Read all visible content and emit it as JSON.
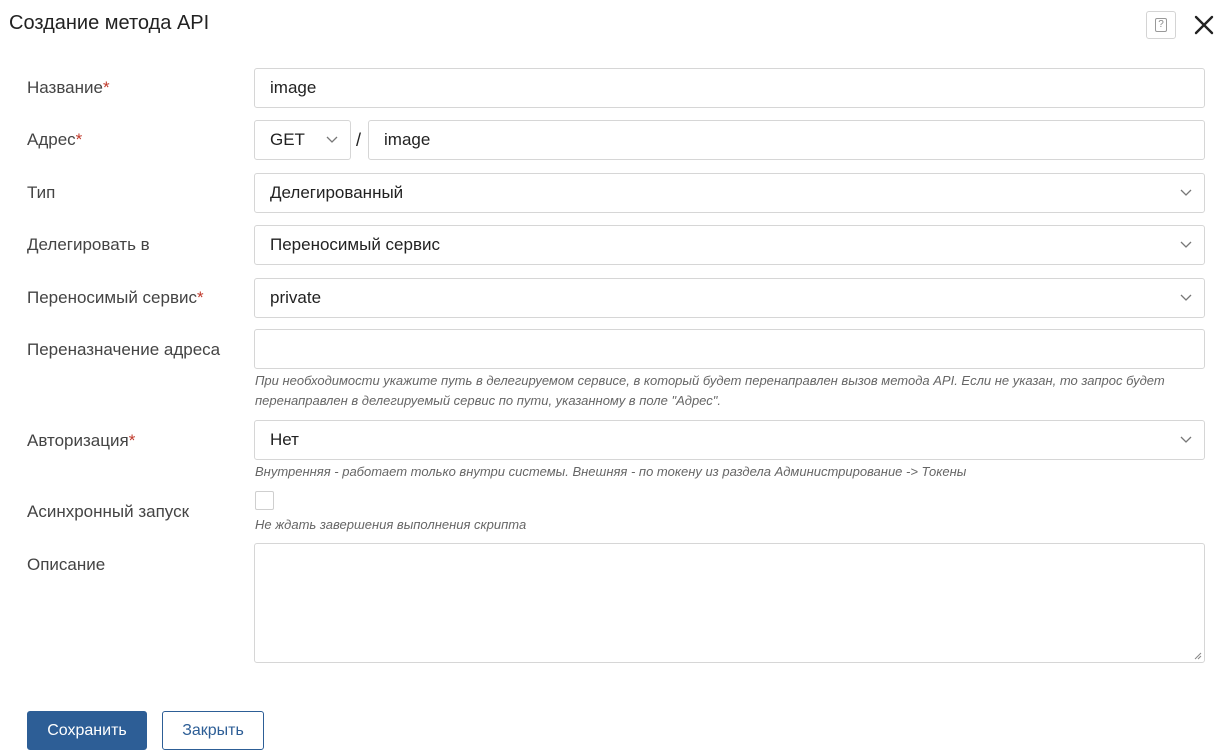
{
  "dialog": {
    "title": "Создание метода API"
  },
  "form": {
    "name": {
      "label": "Название",
      "required_mark": "*",
      "value": "image"
    },
    "address": {
      "label": "Адрес",
      "required_mark": "*",
      "method": "GET",
      "separator": "/",
      "path": "image"
    },
    "type": {
      "label": "Тип",
      "value": "Делегированный"
    },
    "delegate_to": {
      "label": "Делегировать в",
      "value": "Переносимый сервис"
    },
    "portable_service": {
      "label": "Переносимый сервис",
      "required_mark": "*",
      "value": "private"
    },
    "readdress": {
      "label": "Переназначение адреса",
      "value": "",
      "hint": "При необходимости укажите путь в делегируемом сервисе, в который будет перенаправлен вызов метода API. Если не указан, то запрос будет перенаправлен в делегируемый сервис по пути, указанному в поле \"Адрес\"."
    },
    "authorization": {
      "label": "Авторизация",
      "required_mark": "*",
      "value": "Нет",
      "hint": "Внутренняя - работает только внутри системы. Внешняя - по токену из раздела Администрирование -> Токены"
    },
    "async": {
      "label": "Асинхронный запуск",
      "checked": false,
      "hint": "Не ждать завершения выполнения скрипта"
    },
    "description": {
      "label": "Описание",
      "value": ""
    }
  },
  "buttons": {
    "save": "Сохранить",
    "close": "Закрыть"
  },
  "icons": {
    "help": "help-icon",
    "close": "close-icon",
    "dropdown": "chevron-down-icon"
  },
  "colors": {
    "primary": "#2d5e96",
    "required": "#c0392b"
  }
}
